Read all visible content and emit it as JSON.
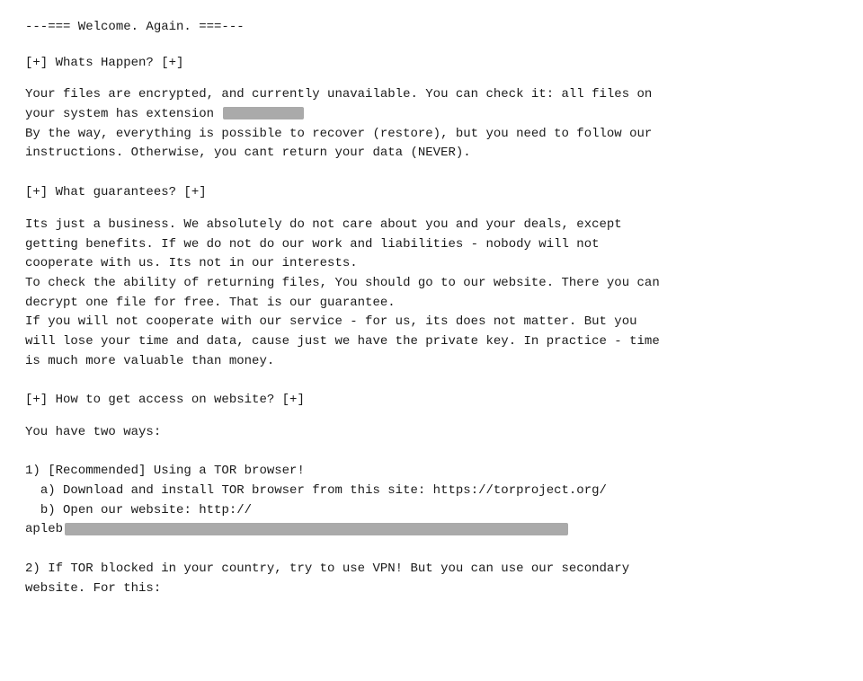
{
  "header": {
    "text": "---=== Welcome. Again. ===---"
  },
  "sections": [
    {
      "id": "whats-happen",
      "heading": "[+] Whats Happen? [+]",
      "paragraphs": [
        "Your files are encrypted, and currently unavailable. You can check it: all files on\nyour system has extension [REDACTED]\nBy the way, everything is possible to recover (restore), but you need to follow our\ninstructions. Otherwise, you cant return your data (NEVER)."
      ]
    },
    {
      "id": "what-guarantees",
      "heading": "[+] What guarantees? [+]",
      "paragraphs": [
        "Its just a business. We absolutely do not care about you and your deals, except\ngetting benefits. If we do not do our work and liabilities - nobody will not\ncooperate with us. Its not in our interests.\nTo check the ability of returning files, You should go to our website. There you can\ndecrypt one file for free. That is our guarantee.\nIf you will not cooperate with our service - for us, its does not matter. But you\nwill lose your time and data, cause just we have the private key. In practice - time\nis much more valuable than money."
      ]
    },
    {
      "id": "how-to-access",
      "heading": "[+] How to get access on website? [+]",
      "paragraphs": [
        "You have two ways:",
        "1) [Recommended] Using a TOR browser!\n  a) Download and install TOR browser from this site: https://torproject.org/\n  b) Open our website: http://\napleb[REDACTED_LONG]",
        "2) If TOR blocked in your country, try to use VPN! But you can use our secondary\nwebsite. For this:"
      ]
    }
  ]
}
